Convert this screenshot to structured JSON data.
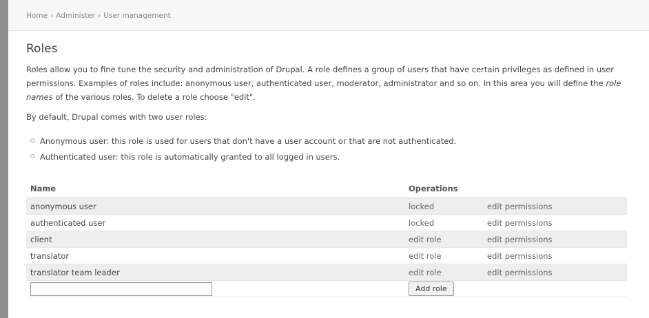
{
  "breadcrumb": [
    "Home",
    "Administer",
    "User management"
  ],
  "breadcrumb_separator": "›",
  "page": {
    "title": "Roles",
    "intro_part1": "Roles allow you to fine tune the security and administration of Drupal. A role defines a group of users that have certain privileges as defined in ",
    "intro_link": "user permissions",
    "intro_part2": ". Examples of roles include: anonymous user, authenticated user, moderator, administrator and so on. In this area you will define the ",
    "intro_emphasis": "role names",
    "intro_part3": " of the various roles. To delete a role choose \"edit\".",
    "default_text": "By default, Drupal comes with two user roles:",
    "default_roles": [
      "Anonymous user: this role is used for users that don't have a user account or that are not authenticated.",
      "Authenticated user: this role is automatically granted to all logged in users."
    ]
  },
  "table": {
    "headers": {
      "name": "Name",
      "operations": "Operations"
    },
    "rows": [
      {
        "name": "anonymous user",
        "op1": "locked",
        "op2": "edit permissions"
      },
      {
        "name": "authenticated user",
        "op1": "locked",
        "op2": "edit permissions"
      },
      {
        "name": "client",
        "op1": "edit role",
        "op2": "edit permissions"
      },
      {
        "name": "translator",
        "op1": "edit role",
        "op2": "edit permissions"
      },
      {
        "name": "translator team leader",
        "op1": "edit role",
        "op2": "edit permissions"
      }
    ],
    "new_role_value": "",
    "add_button_label": "Add role"
  }
}
